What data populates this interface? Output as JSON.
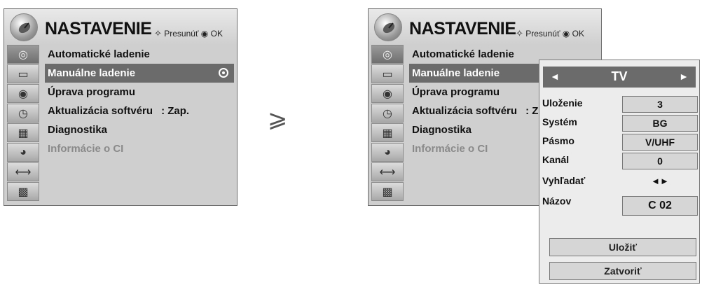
{
  "menu": {
    "title": "NASTAVENIE",
    "hint_glyph": "✧",
    "hint_move": "Presunúť",
    "hint_ok_glyph": "◉",
    "hint_ok": "OK",
    "sidebar_icons": [
      "satellite-dish-icon",
      "tv-screen-icon",
      "disc-icon",
      "clock-icon",
      "calendar-icon",
      "lock-icon",
      "plug-icon",
      "clapper-icon"
    ],
    "items": [
      {
        "label": "Automatické ladenie"
      },
      {
        "label": "Manuálne ladenie"
      },
      {
        "label": "Úprava programu"
      },
      {
        "label": "Aktualizácia softvéru",
        "value": ": Zap."
      },
      {
        "label": "Diagnostika"
      },
      {
        "label": "Informácie o CI"
      }
    ],
    "right_items_update": {
      "label": "Aktualizácia softvéru",
      "value": ": Z"
    }
  },
  "transition_arrow": "⩾",
  "popup": {
    "left_arrow": "◄",
    "header": "TV",
    "right_arrow": "►",
    "fields": [
      {
        "label": "Uloženie",
        "value": "3"
      },
      {
        "label": "Systém",
        "value": "BG"
      },
      {
        "label": "Pásmo",
        "value": "V/UHF"
      },
      {
        "label": "Kanál",
        "value": "0"
      },
      {
        "label": "Vyhľadať",
        "value": "◄►"
      },
      {
        "label": "Názov",
        "value": "C  02"
      }
    ],
    "save_button": "Uložiť",
    "close_button": "Zatvoriť"
  }
}
